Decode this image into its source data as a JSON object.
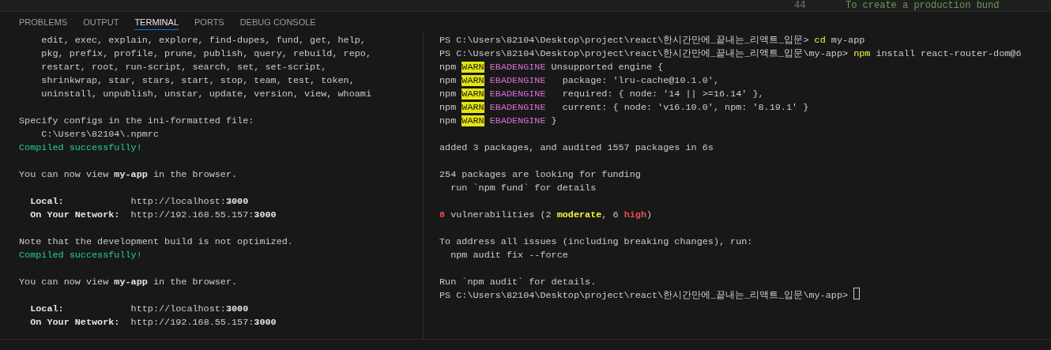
{
  "editor_strip": {
    "line_number": "44",
    "text": "To create a production bund"
  },
  "tabs": [
    {
      "label": "PROBLEMS",
      "selected": false
    },
    {
      "label": "OUTPUT",
      "selected": false
    },
    {
      "label": "TERMINAL",
      "selected": true
    },
    {
      "label": "PORTS",
      "selected": false
    },
    {
      "label": "DEBUG CONSOLE",
      "selected": false
    }
  ],
  "terminals": [
    {
      "lines": [
        {
          "kind": "text",
          "segments": [
            {
              "kind": "plain",
              "text": "    edit, exec, explain, explore, find-dupes, fund, get, help,"
            }
          ]
        },
        {
          "kind": "text",
          "segments": [
            {
              "kind": "plain",
              "text": "    pkg, prefix, profile, prune, publish, query, rebuild, repo,"
            }
          ]
        },
        {
          "kind": "text",
          "segments": [
            {
              "kind": "plain",
              "text": "    restart, root, run-script, search, set, set-script,"
            }
          ]
        },
        {
          "kind": "text",
          "segments": [
            {
              "kind": "plain",
              "text": "    shrinkwrap, star, stars, start, stop, team, test, token,"
            }
          ]
        },
        {
          "kind": "text",
          "segments": [
            {
              "kind": "plain",
              "text": "    uninstall, unpublish, unstar, update, version, view, whoami"
            }
          ]
        },
        {
          "kind": "blank"
        },
        {
          "kind": "text",
          "segments": [
            {
              "kind": "plain",
              "text": "Specify configs in the ini-formatted file:"
            }
          ]
        },
        {
          "kind": "text",
          "segments": [
            {
              "kind": "plain",
              "text": "    C:\\Users\\82104\\.npmrc"
            }
          ]
        },
        {
          "kind": "text",
          "segments": [
            {
              "kind": "green",
              "text": "Compiled successfully!"
            }
          ]
        },
        {
          "kind": "blank"
        },
        {
          "kind": "text",
          "segments": [
            {
              "kind": "plain",
              "text": "You can now view "
            },
            {
              "kind": "bold",
              "text": "my-app"
            },
            {
              "kind": "plain",
              "text": " in the browser."
            }
          ]
        },
        {
          "kind": "blank"
        },
        {
          "kind": "text",
          "segments": [
            {
              "kind": "bold",
              "text": "  Local:"
            },
            {
              "kind": "plain",
              "text": "            http://localhost:"
            },
            {
              "kind": "bold",
              "text": "3000"
            }
          ]
        },
        {
          "kind": "text",
          "segments": [
            {
              "kind": "bold",
              "text": "  On Your Network:"
            },
            {
              "kind": "plain",
              "text": "  http://192.168.55.157:"
            },
            {
              "kind": "bold",
              "text": "3000"
            }
          ]
        },
        {
          "kind": "blank"
        },
        {
          "kind": "text",
          "segments": [
            {
              "kind": "plain",
              "text": "Note that the development build is not optimized."
            }
          ]
        },
        {
          "kind": "text",
          "segments": [
            {
              "kind": "green",
              "text": "Compiled successfully!"
            }
          ]
        },
        {
          "kind": "blank"
        },
        {
          "kind": "text",
          "segments": [
            {
              "kind": "plain",
              "text": "You can now view "
            },
            {
              "kind": "bold",
              "text": "my-app"
            },
            {
              "kind": "plain",
              "text": " in the browser."
            }
          ]
        },
        {
          "kind": "blank"
        },
        {
          "kind": "text",
          "segments": [
            {
              "kind": "bold",
              "text": "  Local:"
            },
            {
              "kind": "plain",
              "text": "            http://localhost:"
            },
            {
              "kind": "bold",
              "text": "3000"
            }
          ]
        },
        {
          "kind": "text",
          "segments": [
            {
              "kind": "bold",
              "text": "  On Your Network:"
            },
            {
              "kind": "plain",
              "text": "  http://192.168.55.157:"
            },
            {
              "kind": "bold",
              "text": "3000"
            }
          ]
        }
      ]
    },
    {
      "lines": [
        {
          "kind": "text",
          "segments": [
            {
              "kind": "plain",
              "text": "PS C:\\Users\\82104\\Desktop\\project\\react\\한시간만에_끝내는_리액트_입문> "
            },
            {
              "kind": "yellow",
              "text": "cd"
            },
            {
              "kind": "plain",
              "text": " my-app"
            }
          ]
        },
        {
          "kind": "text",
          "segments": [
            {
              "kind": "plain",
              "text": "PS C:\\Users\\82104\\Desktop\\project\\react\\한시간만에_끝내는_리액트_입문\\my-app> "
            },
            {
              "kind": "yellow",
              "text": "npm"
            },
            {
              "kind": "plain",
              "text": " install react-router-dom@6"
            }
          ]
        },
        {
          "kind": "text",
          "segments": [
            {
              "kind": "plain",
              "text": "npm "
            },
            {
              "kind": "warn",
              "text": "WARN"
            },
            {
              "kind": "magenta",
              "text": " EBADENGINE"
            },
            {
              "kind": "plain",
              "text": " Unsupported engine {"
            }
          ]
        },
        {
          "kind": "text",
          "segments": [
            {
              "kind": "plain",
              "text": "npm "
            },
            {
              "kind": "warn",
              "text": "WARN"
            },
            {
              "kind": "magenta",
              "text": " EBADENGINE"
            },
            {
              "kind": "plain",
              "text": "   package: 'lru-cache@10.1.0',"
            }
          ]
        },
        {
          "kind": "text",
          "segments": [
            {
              "kind": "plain",
              "text": "npm "
            },
            {
              "kind": "warn",
              "text": "WARN"
            },
            {
              "kind": "magenta",
              "text": " EBADENGINE"
            },
            {
              "kind": "plain",
              "text": "   required: { node: '14 || >=16.14' },"
            }
          ]
        },
        {
          "kind": "text",
          "segments": [
            {
              "kind": "plain",
              "text": "npm "
            },
            {
              "kind": "warn",
              "text": "WARN"
            },
            {
              "kind": "magenta",
              "text": " EBADENGINE"
            },
            {
              "kind": "plain",
              "text": "   current: { node: 'v16.10.0', npm: '8.19.1' }"
            }
          ]
        },
        {
          "kind": "text",
          "segments": [
            {
              "kind": "plain",
              "text": "npm "
            },
            {
              "kind": "warn",
              "text": "WARN"
            },
            {
              "kind": "magenta",
              "text": " EBADENGINE"
            },
            {
              "kind": "plain",
              "text": " }"
            }
          ]
        },
        {
          "kind": "blank"
        },
        {
          "kind": "text",
          "segments": [
            {
              "kind": "plain",
              "text": "added 3 packages, and audited 1557 packages in 6s"
            }
          ]
        },
        {
          "kind": "blank"
        },
        {
          "kind": "text",
          "segments": [
            {
              "kind": "plain",
              "text": "254 packages are looking for funding"
            }
          ]
        },
        {
          "kind": "text",
          "segments": [
            {
              "kind": "plain",
              "text": "  run `npm fund` for details"
            }
          ]
        },
        {
          "kind": "blank"
        },
        {
          "kind": "text",
          "segments": [
            {
              "kind": "red",
              "text": "8"
            },
            {
              "kind": "plain",
              "text": " vulnerabilities (2 "
            },
            {
              "kind": "yellowbold",
              "text": "moderate"
            },
            {
              "kind": "plain",
              "text": ", 6 "
            },
            {
              "kind": "red",
              "text": "high"
            },
            {
              "kind": "plain",
              "text": ")"
            }
          ]
        },
        {
          "kind": "blank"
        },
        {
          "kind": "text",
          "segments": [
            {
              "kind": "plain",
              "text": "To address all issues (including breaking changes), run:"
            }
          ]
        },
        {
          "kind": "text",
          "segments": [
            {
              "kind": "plain",
              "text": "  npm audit fix --force"
            }
          ]
        },
        {
          "kind": "blank"
        },
        {
          "kind": "text",
          "segments": [
            {
              "kind": "plain",
              "text": "Run `npm audit` for details."
            }
          ]
        },
        {
          "kind": "text",
          "segments": [
            {
              "kind": "plain",
              "text": "PS C:\\Users\\82104\\Desktop\\project\\react\\한시간만에_끝내는_리액트_입문\\my-app> "
            }
          ]
        }
      ],
      "cursor": true
    }
  ]
}
